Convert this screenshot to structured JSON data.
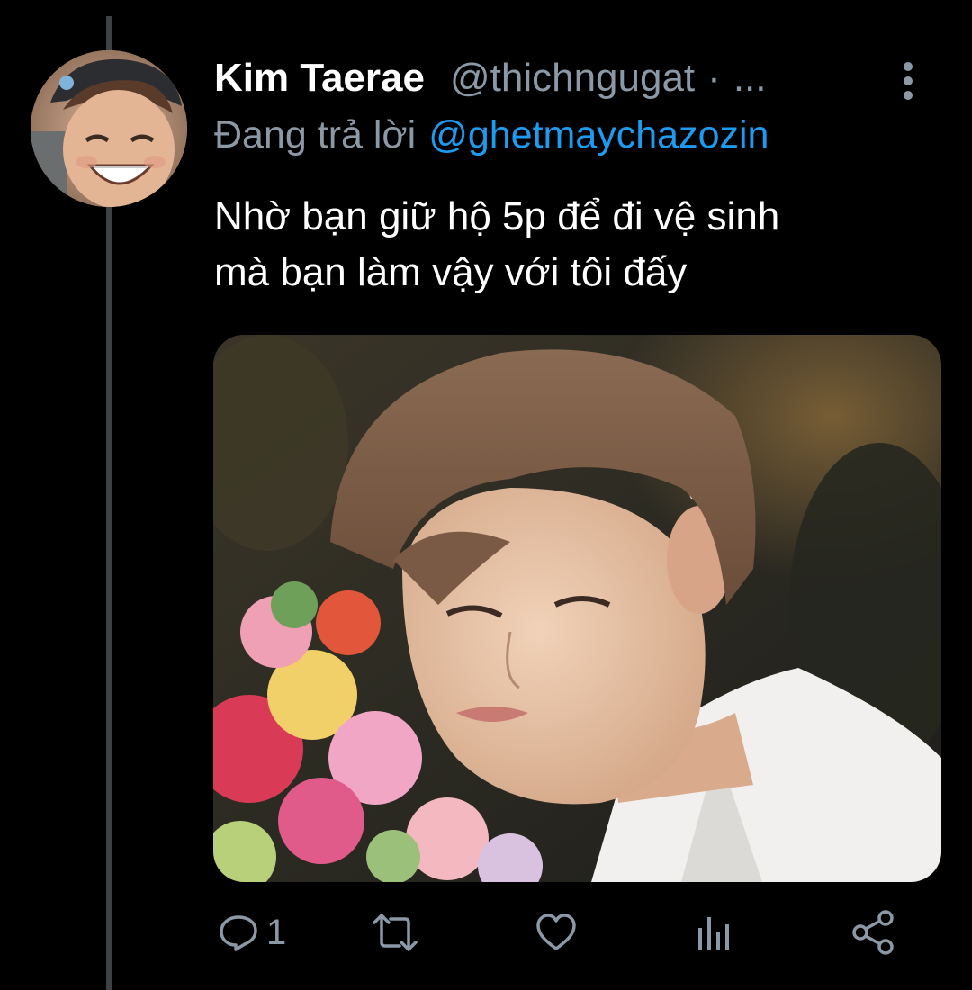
{
  "tweet": {
    "display_name": "Kim Taerae",
    "handle": "@thichngugat",
    "separator": "·",
    "truncation": "...",
    "reply_prefix": "Đang trả lời",
    "reply_to": "@ghetmaychazozin",
    "text_lines": [
      "Nhờ bạn giữ hộ 5p để đi vệ sinh",
      "mà bạn làm vậy với tôi đấy"
    ],
    "media": {
      "description_icon": "photo"
    }
  },
  "actions": {
    "reply_icon": "reply-icon",
    "reply_count": "1",
    "retweet_icon": "retweet-icon",
    "like_icon": "heart-icon",
    "analytics_icon": "analytics-icon",
    "share_icon": "share-icon"
  },
  "colors": {
    "background": "#000000",
    "text_primary": "#ffffff",
    "text_secondary": "#8b98a5",
    "link": "#1d9bf0",
    "thread_line": "#3d4247"
  }
}
